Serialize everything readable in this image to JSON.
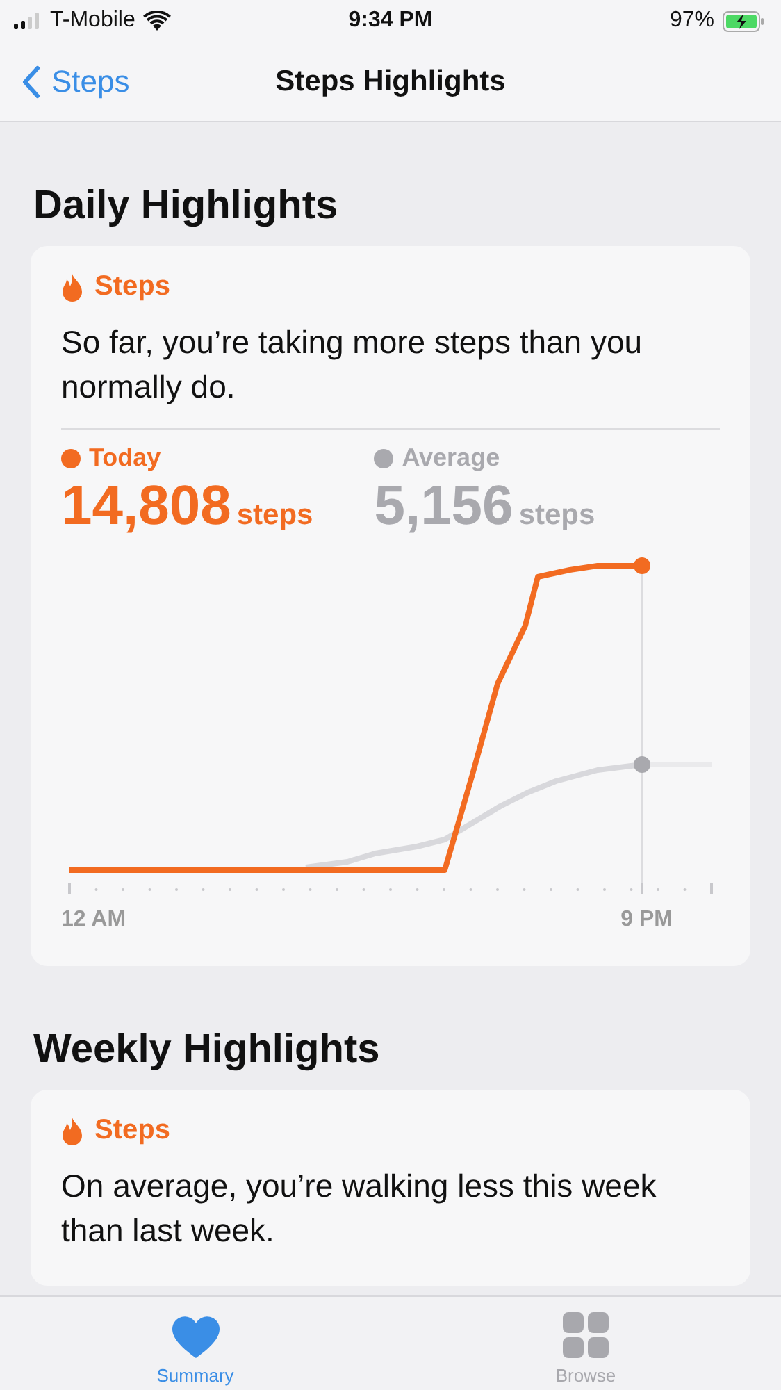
{
  "status_bar": {
    "carrier": "T-Mobile",
    "time": "9:34 PM",
    "battery": "97%"
  },
  "nav": {
    "back": "Steps",
    "title": "Steps Highlights"
  },
  "sections": [
    {
      "heading": "Daily Highlights",
      "card": {
        "category": "Steps",
        "message": "So far, you’re taking more steps than you normally do.",
        "legend": [
          {
            "label": "Today",
            "value": "14,808",
            "unit": "steps",
            "color": "#f26b21"
          },
          {
            "label": "Average",
            "value": "5,156",
            "unit": "steps",
            "color": "#a9a9ae"
          }
        ],
        "axis_labels": [
          "12 AM",
          "9 PM"
        ]
      }
    },
    {
      "heading": "Weekly Highlights",
      "card": {
        "category": "Steps",
        "message": "On average, you’re walking less this week than last week."
      }
    }
  ],
  "tabs": [
    {
      "label": "Summary",
      "kind": "heart",
      "selected": true
    },
    {
      "label": "Browse",
      "kind": "grid",
      "selected": false
    }
  ]
}
